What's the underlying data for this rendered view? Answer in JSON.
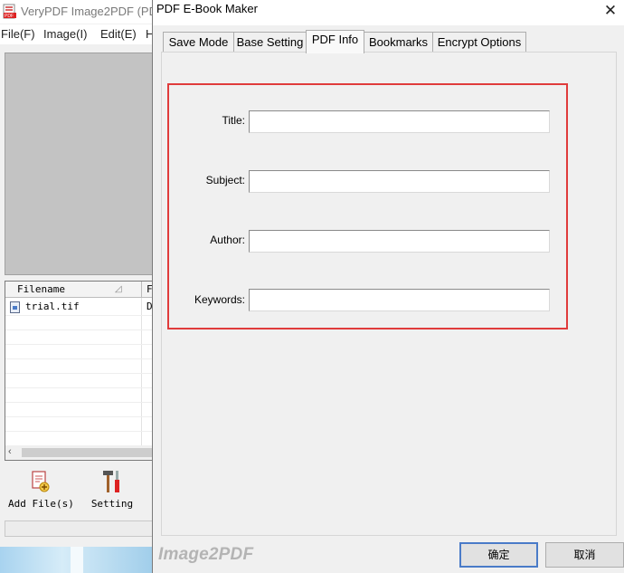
{
  "app": {
    "title": "VeryPDF Image2PDF (PDF",
    "menu": [
      "File(F)",
      "Image(I)",
      "Edit(E)",
      "H"
    ],
    "file_list": {
      "columns": [
        "Filename",
        "F"
      ],
      "rows": [
        {
          "name": "trial.tif",
          "col2": "D"
        }
      ]
    },
    "toolbar": {
      "add_files_label": "Add File(s)",
      "setting_label": "Setting"
    }
  },
  "dialog": {
    "title": "PDF E-Book Maker",
    "close_glyph": "✕",
    "tabs": [
      {
        "label": "Save Mode",
        "active": false
      },
      {
        "label": "Base Setting",
        "active": false
      },
      {
        "label": "PDF Info",
        "active": true
      },
      {
        "label": "Bookmarks",
        "active": false
      },
      {
        "label": "Encrypt Options",
        "active": false
      }
    ],
    "fields": {
      "title": {
        "label": "Title:",
        "value": ""
      },
      "subject": {
        "label": "Subject:",
        "value": ""
      },
      "author": {
        "label": "Author:",
        "value": ""
      },
      "keywords": {
        "label": "Keywords:",
        "value": ""
      }
    },
    "brand": "Image2PDF",
    "ok_label": "确定",
    "cancel_label": "取消"
  },
  "colors": {
    "highlight_border": "#e03b3b",
    "default_button_border": "#4a7bc8",
    "window_bg": "#f0f0f0"
  },
  "icons": {
    "app": "pdf-app-icon",
    "add_files": "add-files-icon",
    "setting": "tools-icon",
    "file": "image-file-icon",
    "close": "close-icon"
  }
}
